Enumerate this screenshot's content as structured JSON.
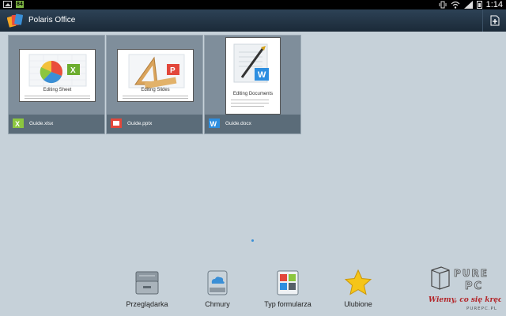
{
  "statusbar": {
    "time": "1:14",
    "badge": "84",
    "icons": [
      "image-icon",
      "notification-badge-icon",
      "vibrate-icon",
      "wifi-icon",
      "signal-icon",
      "battery-icon"
    ]
  },
  "actionbar": {
    "title": "Polaris Office",
    "new_button_icon": "new-document-icon"
  },
  "documents": [
    {
      "file_name": "Guide.xlsx",
      "thumb_title": "Editing Sheet",
      "icon": "excel-icon",
      "icon_color": "#8cc63f"
    },
    {
      "file_name": "Guide.pptx",
      "thumb_title": "Editing Slides",
      "icon": "powerpoint-icon",
      "icon_color": "#e2473b"
    },
    {
      "file_name": "Guide.docx",
      "thumb_title": "Editing Documents",
      "icon": "word-icon",
      "icon_color": "#2d8ee0"
    }
  ],
  "dock": [
    {
      "label": "Przeglądarka",
      "icon": "file-browser-icon"
    },
    {
      "label": "Chmury",
      "icon": "cloud-icon"
    },
    {
      "label": "Typ formularza",
      "icon": "form-type-icon"
    },
    {
      "label": "Ulubione",
      "icon": "star-icon"
    }
  ],
  "watermark": {
    "brand": "PURE PC",
    "slogan": "Wiemy, co się kręci!",
    "site": "PUREPC.PL"
  },
  "colors": {
    "background": "#c6d1d9",
    "actionbar": "#1e2f3e",
    "tile": "#7f8e9b",
    "tile_footer": "#5b6c79",
    "accent": "#3a8fd6"
  }
}
